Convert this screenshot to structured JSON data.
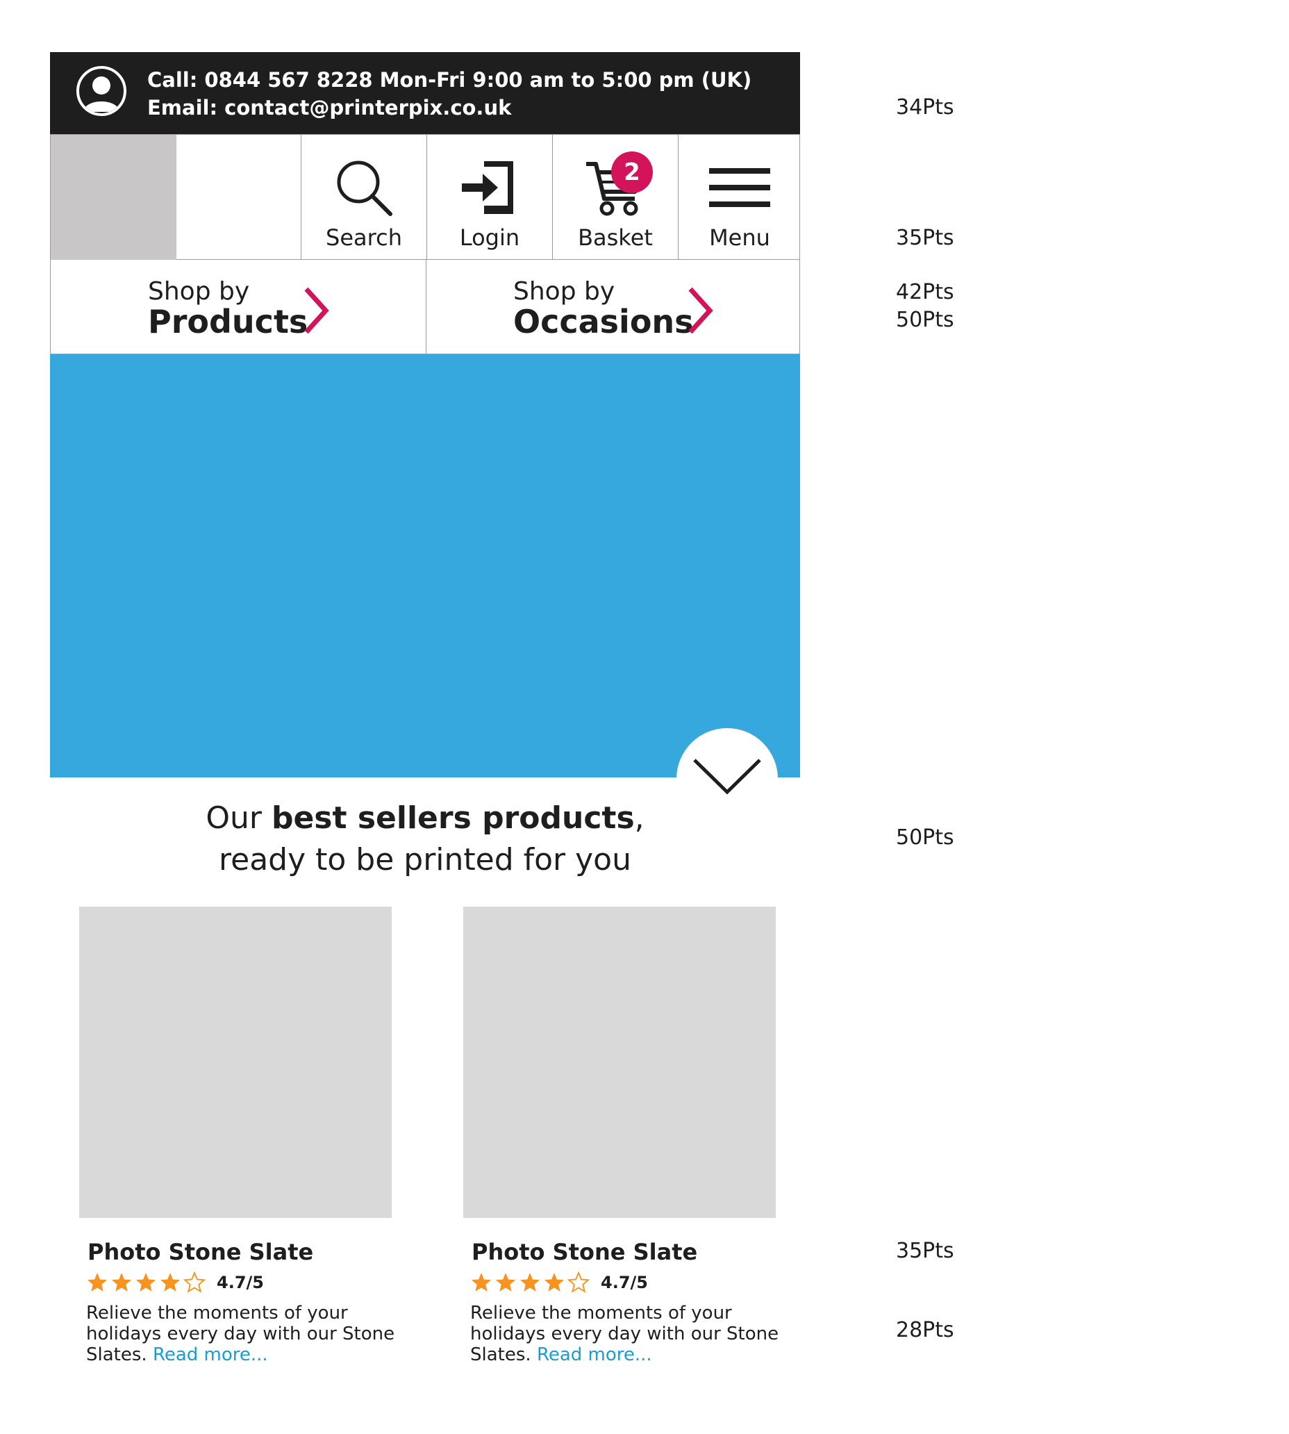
{
  "topbar": {
    "call": "Call: 0844 567 8228 Mon-Fri 9:00 am to 5:00 pm (UK)",
    "email": "Email: contact@printerpix.co.uk"
  },
  "nav": {
    "search": "Search",
    "login": "Login",
    "basket": "Basket",
    "basket_count": "2",
    "menu": "Menu"
  },
  "shop": {
    "products_small": "Shop by",
    "products_big": "Products",
    "occasions_small": "Shop by",
    "occasions_big": "Occasions"
  },
  "section": {
    "heading_pre": "Our ",
    "heading_bold": "best sellers products",
    "heading_post": ",",
    "heading_line2": "ready to be printed for you"
  },
  "products": [
    {
      "title": "Photo Stone Slate",
      "rating": "4.7/5",
      "stars_filled": 4,
      "stars_total": 5,
      "desc": "Relieve the moments of your holidays every day with our Stone Slates.",
      "more": "Read more..."
    },
    {
      "title": "Photo Stone Slate",
      "rating": "4.7/5",
      "stars_filled": 4,
      "stars_total": 5,
      "desc": "Relieve the moments of your holidays every day with our Stone Slates.",
      "more": "Read more..."
    }
  ],
  "annotations": {
    "a1": "34Pts",
    "a2": "35Pts",
    "a3": "42Pts",
    "a4": "50Pts",
    "a5": "50Pts",
    "a6": "35Pts",
    "a7": "28Pts"
  },
  "colors": {
    "topbar": "#1e1e1e",
    "hero": "#37a8de",
    "accent_pink": "#d4145a",
    "star": "#f7931e",
    "link": "#1b9cd8",
    "placeholder": "#d9d9d9"
  },
  "icons": {
    "account": "user-circle-icon",
    "search": "search-icon",
    "login": "login-icon",
    "basket": "cart-icon",
    "menu": "hamburger-icon",
    "chevron": "chevron-right-icon",
    "scroll": "chevron-down-icon"
  }
}
